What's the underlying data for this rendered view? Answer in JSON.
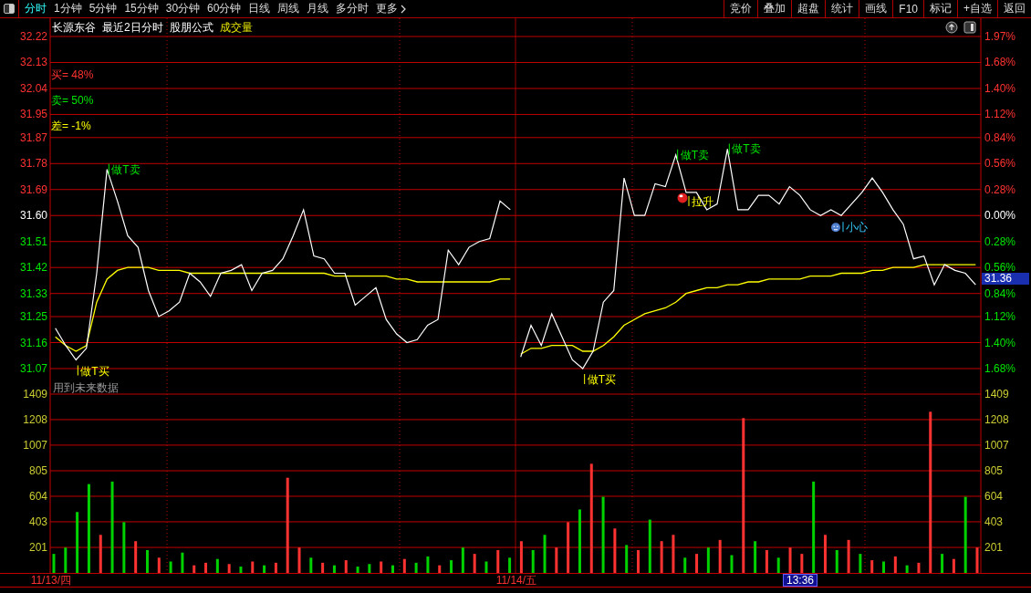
{
  "toolbar": {
    "tabs": [
      {
        "label": "分时",
        "selected": true,
        "kind": "tab"
      },
      {
        "label": "1分钟",
        "selected": false,
        "kind": "tab"
      },
      {
        "label": "5分钟",
        "selected": false,
        "kind": "tab"
      },
      {
        "label": "15分钟",
        "selected": false,
        "kind": "tab"
      },
      {
        "label": "30分钟",
        "selected": false,
        "kind": "tab"
      },
      {
        "label": "60分钟",
        "selected": false,
        "kind": "tab"
      },
      {
        "label": "日线",
        "selected": false,
        "kind": "tab"
      },
      {
        "label": "周线",
        "selected": false,
        "kind": "tab"
      },
      {
        "label": "月线",
        "selected": false,
        "kind": "tab"
      },
      {
        "label": "多分时",
        "selected": false,
        "kind": "tab"
      },
      {
        "label": "更多",
        "selected": false,
        "kind": "menu"
      }
    ],
    "buttons": [
      "竞价",
      "叠加",
      "超盘",
      "统计",
      "画线",
      "F10",
      "标记",
      "+自选",
      "返回"
    ]
  },
  "price_chart": {
    "title": "长源东谷",
    "info": [
      {
        "text": "最近2日分时",
        "kind": "plain"
      },
      {
        "text": "股朋公式",
        "kind": "plain"
      },
      {
        "text": "成交量",
        "kind": "indicator"
      }
    ],
    "legend": [
      {
        "text": "买= 48%",
        "color": "#ff3232"
      },
      {
        "text": "卖= 50%",
        "color": "#00e600"
      },
      {
        "text": "差= -1%",
        "color": "#ffff00"
      }
    ],
    "note": "用到未来数据",
    "right_axis": [
      {
        "text": "1.97%",
        "kind": "up"
      },
      {
        "text": "1.68%",
        "kind": "up"
      },
      {
        "text": "1.40%",
        "kind": "up"
      },
      {
        "text": "1.12%",
        "kind": "up"
      },
      {
        "text": "0.84%",
        "kind": "up"
      },
      {
        "text": "0.56%",
        "kind": "up"
      },
      {
        "text": "0.28%",
        "kind": "up"
      },
      {
        "text": "0.00%",
        "kind": "flat"
      },
      {
        "text": "0.28%",
        "kind": "down"
      },
      {
        "text": "0.56%",
        "kind": "down"
      },
      {
        "text": "0.84%",
        "kind": "down"
      },
      {
        "text": "1.12%",
        "kind": "down"
      },
      {
        "text": "1.40%",
        "kind": "down"
      },
      {
        "text": "1.68%",
        "kind": "down"
      }
    ],
    "current_price": "31.36",
    "signal_styles": [
      {
        "kind": "sell"
      },
      {
        "kind": "buy"
      },
      {
        "kind": "buy"
      },
      {
        "kind": "sell"
      },
      {
        "kind": "rise"
      },
      {
        "kind": "sell"
      },
      {
        "kind": "caution"
      }
    ],
    "chart_data": {
      "type": "line",
      "grid": true,
      "ylim": [
        31.07,
        32.22
      ],
      "yticks": [
        32.22,
        32.13,
        32.04,
        31.95,
        31.87,
        31.78,
        31.69,
        {
          "value": 31.6,
          "label": "31.60"
        },
        31.51,
        31.42,
        31.33,
        31.25,
        31.16,
        31.07
      ],
      "series": [
        {
          "color": "#ffffff",
          "values": [
            31.21,
            31.15,
            31.1,
            31.14,
            31.4,
            31.76,
            31.65,
            31.53,
            31.49,
            31.34,
            31.25,
            31.27,
            31.3,
            31.4,
            31.37,
            31.32,
            31.4,
            31.41,
            31.43,
            31.34,
            31.4,
            31.41,
            31.45,
            31.53,
            31.62,
            31.46,
            31.45,
            31.4,
            31.4,
            31.29,
            31.32,
            31.35,
            31.24,
            31.19,
            31.16,
            31.17,
            31.22,
            31.24,
            31.48,
            31.43,
            31.49,
            31.51,
            31.52,
            31.65,
            31.62,
            31.11,
            31.22,
            31.15,
            31.26,
            31.18,
            31.1,
            31.07,
            31.13,
            31.3,
            31.34,
            31.73,
            31.6,
            31.6,
            31.71,
            31.7,
            31.81,
            31.68,
            31.68,
            31.62,
            31.64,
            31.83,
            31.62,
            31.62,
            31.67,
            31.67,
            31.64,
            31.7,
            31.67,
            31.62,
            31.6,
            31.62,
            31.6,
            31.64,
            31.68,
            31.73,
            31.68,
            31.62,
            31.57,
            31.45,
            31.46,
            31.36,
            31.43,
            31.41,
            31.4,
            31.36
          ]
        },
        {
          "color": "#ffff00",
          "values": [
            31.18,
            31.15,
            31.13,
            31.15,
            31.3,
            31.38,
            31.41,
            31.42,
            31.42,
            31.42,
            31.41,
            31.41,
            31.41,
            31.4,
            31.4,
            31.4,
            31.4,
            31.4,
            31.4,
            31.4,
            31.4,
            31.4,
            31.4,
            31.4,
            31.4,
            31.4,
            31.4,
            31.39,
            31.39,
            31.39,
            31.39,
            31.39,
            31.39,
            31.38,
            31.38,
            31.37,
            31.37,
            31.37,
            31.37,
            31.37,
            31.37,
            31.37,
            31.37,
            31.38,
            31.38,
            31.12,
            31.14,
            31.14,
            31.15,
            31.15,
            31.15,
            31.13,
            31.13,
            31.15,
            31.18,
            31.22,
            31.24,
            31.26,
            31.27,
            31.28,
            31.3,
            31.33,
            31.34,
            31.35,
            31.35,
            31.36,
            31.36,
            31.37,
            31.37,
            31.38,
            31.38,
            31.38,
            31.38,
            31.39,
            31.39,
            31.39,
            31.4,
            31.4,
            31.4,
            31.41,
            31.41,
            31.42,
            31.42,
            31.42,
            31.43,
            31.43,
            31.43,
            31.43,
            31.43,
            31.43
          ]
        }
      ],
      "annotations": [
        "做T卖",
        "做T买",
        "做T买",
        "做T卖",
        "拉升",
        "做T卖",
        "小心"
      ]
    }
  },
  "volume_chart": {
    "right_axis": [
      "1409",
      "1208",
      "1007",
      "805",
      "604",
      "403",
      "201"
    ],
    "chart_data": {
      "type": "bar",
      "grid": true,
      "ylim": [
        0,
        1409
      ],
      "yticks": [
        1409,
        1208,
        1007,
        805,
        604,
        403,
        201
      ],
      "series": [
        {
          "color": "#ff3232",
          "values": [
            null,
            null,
            null,
            null,
            300,
            null,
            null,
            250,
            null,
            120,
            null,
            null,
            60,
            80,
            null,
            70,
            null,
            90,
            null,
            80,
            750,
            200,
            null,
            80,
            null,
            100,
            null,
            null,
            90,
            null,
            110,
            null,
            null,
            60,
            null,
            null,
            150,
            null,
            180,
            null,
            250,
            null,
            null,
            200,
            400,
            null,
            860,
            null,
            350,
            null,
            180,
            null,
            250,
            300,
            null,
            150,
            null,
            260,
            null,
            1220,
            null,
            180,
            null,
            200,
            150,
            null,
            300,
            null,
            260,
            null,
            100,
            null,
            130,
            null,
            80,
            1270,
            null,
            110,
            null,
            200
          ]
        },
        {
          "color": "#00d200",
          "values": [
            150,
            200,
            480,
            700,
            null,
            720,
            400,
            null,
            180,
            null,
            90,
            160,
            null,
            null,
            110,
            null,
            50,
            null,
            60,
            null,
            null,
            null,
            120,
            null,
            60,
            null,
            50,
            70,
            null,
            60,
            null,
            80,
            130,
            null,
            100,
            200,
            null,
            90,
            null,
            120,
            null,
            180,
            300,
            null,
            null,
            500,
            null,
            600,
            null,
            220,
            null,
            420,
            null,
            null,
            120,
            null,
            200,
            null,
            140,
            null,
            250,
            null,
            120,
            null,
            null,
            720,
            null,
            180,
            null,
            150,
            null,
            90,
            null,
            60,
            null,
            null,
            150,
            null,
            600,
            null
          ]
        }
      ]
    }
  },
  "time_axis": [
    {
      "label": "11/13/四",
      "selected": false
    },
    {
      "label": "11/14/五",
      "selected": false
    },
    {
      "label": "13:36",
      "selected": true
    }
  ]
}
